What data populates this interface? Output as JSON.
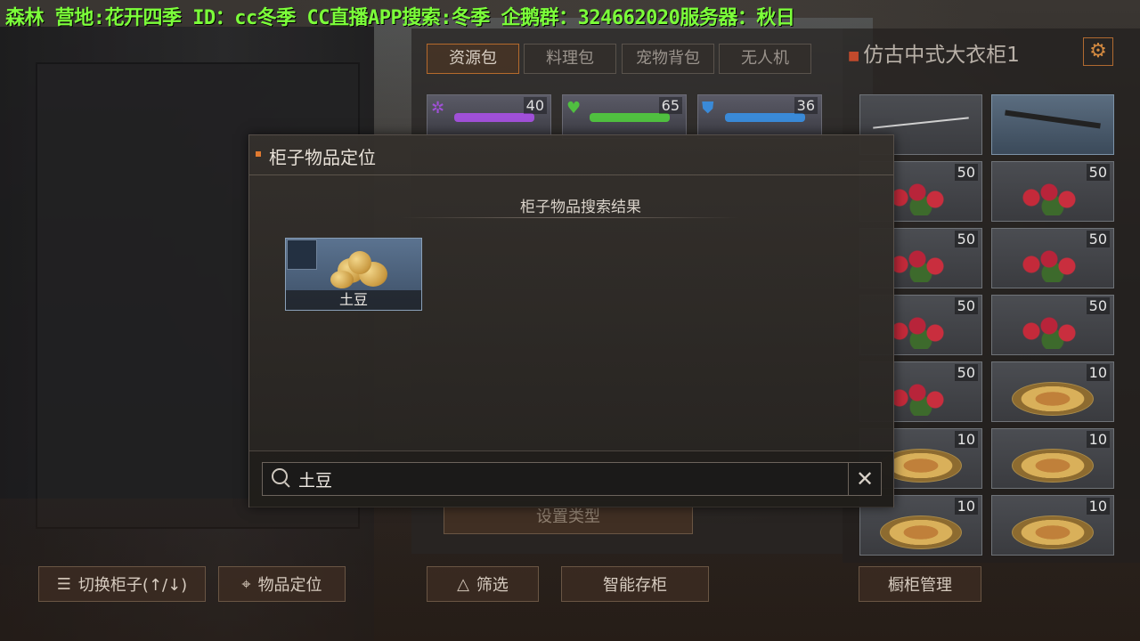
{
  "stream_overlay": "森林 营地:花开四季 ID：cc冬季  CC直播APP搜索:冬季 企鹅群：324662020服务器：秋日",
  "inventory": {
    "tabs": [
      "资源包",
      "料理包",
      "宠物背包",
      "无人机"
    ],
    "active_tab": "资源包",
    "slots": [
      {
        "count": "40",
        "icon": "virus-icon",
        "color": "#a050d8"
      },
      {
        "count": "65",
        "icon": "heart-plus-icon",
        "color": "#50c040"
      },
      {
        "count": "36",
        "icon": "shield-icon",
        "color": "#3a8ad8"
      }
    ],
    "set_type_label": "设置类型"
  },
  "cabinet": {
    "title": "仿古中式大衣柜1",
    "settings_icon": "gear-icon",
    "slots": [
      {
        "type": "bow",
        "count": ""
      },
      {
        "type": "rifle",
        "count": ""
      },
      {
        "type": "berries",
        "count": "50"
      },
      {
        "type": "berries",
        "count": "50"
      },
      {
        "type": "berries",
        "count": "50"
      },
      {
        "type": "berries",
        "count": "50"
      },
      {
        "type": "berries",
        "count": "50"
      },
      {
        "type": "berries",
        "count": "50"
      },
      {
        "type": "berries",
        "count": "50"
      },
      {
        "type": "can",
        "count": "10"
      },
      {
        "type": "can",
        "count": "10"
      },
      {
        "type": "can",
        "count": "10"
      },
      {
        "type": "can",
        "count": "10"
      },
      {
        "type": "can",
        "count": "10"
      }
    ],
    "manage_label": "橱柜管理"
  },
  "bottom_bar": {
    "switch_cabinet": "切换柜子(↑/↓)",
    "item_locate": "物品定位",
    "filter": "筛选",
    "smart_store": "智能存柜"
  },
  "modal": {
    "title": "柜子物品定位",
    "results_label": "柜子物品搜索结果",
    "results": [
      {
        "name": "土豆",
        "icon": "potato-icon"
      }
    ],
    "search": {
      "value": "土豆",
      "placeholder": ""
    }
  }
}
